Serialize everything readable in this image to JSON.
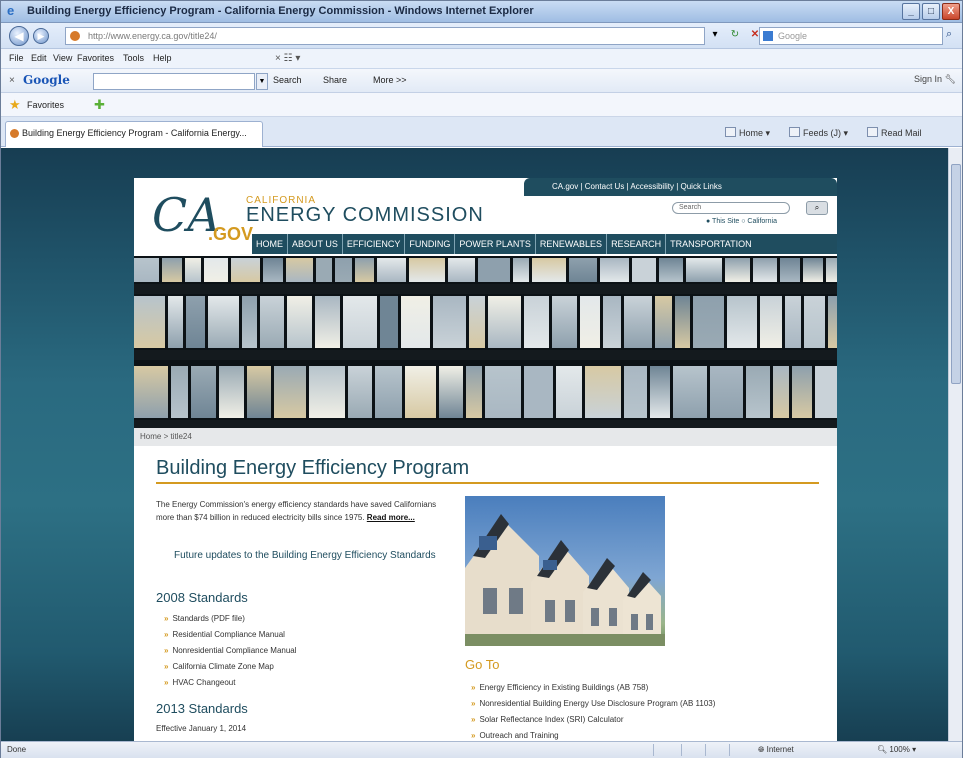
{
  "window": {
    "title": "Building Energy Efficiency Program - California Energy Commission - Windows Internet Explorer",
    "controls": [
      "_",
      "□",
      "X"
    ]
  },
  "address_bar": {
    "url": "http://www.energy.ca.gov/title24/",
    "search_placeholder": "Google"
  },
  "menu": [
    "File",
    "Edit",
    "View",
    "Favorites",
    "Tools",
    "Help"
  ],
  "google_toolbar": {
    "logo": "Google",
    "search_label": "Search",
    "share_label": "Share",
    "more_label": "More >>",
    "signin_label": "Sign In"
  },
  "favorites_bar": {
    "label": "Favorites"
  },
  "tab": {
    "label": "Building Energy Efficiency Program - California Energy..."
  },
  "command_bar": {
    "home": "Home",
    "feeds": "Feeds (J)",
    "read_mail": "Read Mail"
  },
  "site": {
    "util_links": "CA.gov  |  Contact Us  |  Accessibility  |  Quick Links",
    "logo_ca": "CA",
    "logo_gov": ".GOV",
    "org_state": "CALIFORNIA",
    "org_name": "ENERGY COMMISSION",
    "search_placeholder": "Search",
    "search_scope": "● This Site   ○ California",
    "nav": [
      "HOME",
      "ABOUT US",
      "EFFICIENCY",
      "FUNDING",
      "POWER PLANTS",
      "RENEWABLES",
      "RESEARCH",
      "TRANSPORTATION"
    ],
    "breadcrumb": "Home  >  title24",
    "page_title": "Building Energy Efficiency Program",
    "intro_text": "The Energy Commission's energy efficiency standards have saved Californians more than $74 billion in reduced electricity bills since 1975.",
    "intro_more": "Read more...",
    "future_updates": "Future updates to the Building Energy Efficiency Standards",
    "standards_2008": {
      "heading": "2008 Standards",
      "items": [
        "Standards (PDF file)",
        "Residential Compliance Manual",
        "Nonresidential Compliance Manual",
        "California Climate Zone Map",
        "HVAC Changeout"
      ]
    },
    "standards_2013": {
      "heading": "2013 Standards",
      "effective": "Effective January 1, 2014"
    },
    "goto": {
      "heading": "Go To",
      "items": [
        "Energy Efficiency in Existing Buildings (AB 758)",
        "Nonresidential Building Energy Use Disclosure Program (AB 1103)",
        "Solar Reflectance Index (SRI) Calculator",
        "Outreach and Training"
      ]
    }
  },
  "status_bar": {
    "left": "Done",
    "zone": "Internet",
    "zoom": "100%"
  }
}
